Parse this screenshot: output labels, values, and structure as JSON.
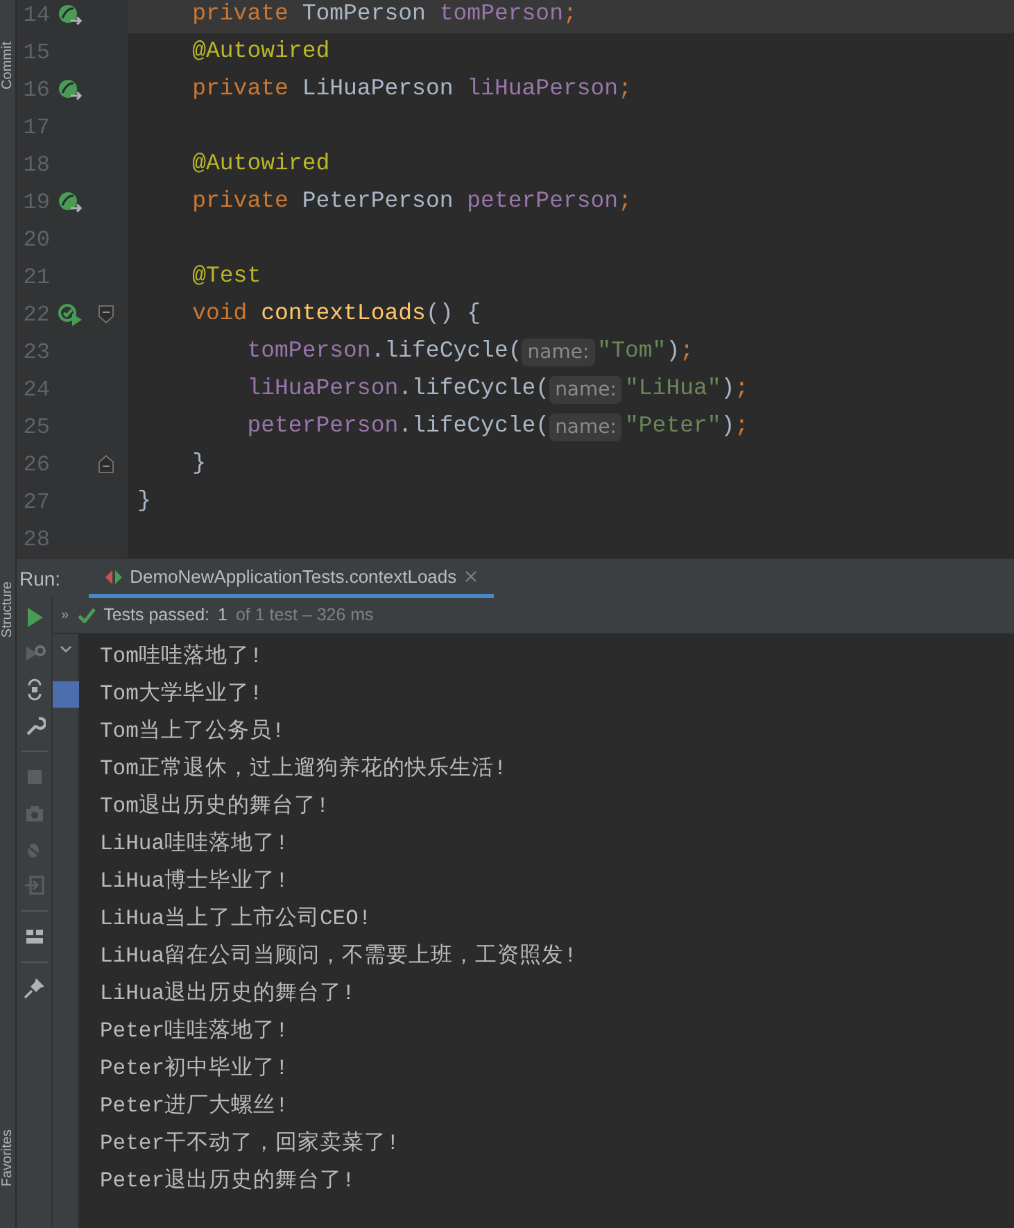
{
  "tool_strip": [
    "Commit",
    "Structure",
    "Favorites"
  ],
  "editor": {
    "lines": [
      {
        "number": "14",
        "gutter": {
          "kind": "bean"
        },
        "current": true,
        "tokens": [
          {
            "kind": "keyword",
            "text": "    private "
          },
          {
            "kind": "type",
            "text": "TomPerson "
          },
          {
            "kind": "field",
            "text": "tomPerson"
          },
          {
            "kind": "semi",
            "text": ";"
          }
        ]
      },
      {
        "number": "15",
        "current": false,
        "tokens": [
          {
            "kind": "annotation",
            "text": "    @Autowired"
          }
        ]
      },
      {
        "number": "16",
        "gutter": {
          "kind": "bean"
        },
        "current": false,
        "tokens": [
          {
            "kind": "keyword",
            "text": "    private "
          },
          {
            "kind": "type",
            "text": "LiHuaPerson "
          },
          {
            "kind": "field",
            "text": "liHuaPerson"
          },
          {
            "kind": "semi",
            "text": ";"
          }
        ]
      },
      {
        "number": "17",
        "current": false
      },
      {
        "number": "18",
        "current": false,
        "tokens": [
          {
            "kind": "annotation",
            "text": "    @Autowired"
          }
        ]
      },
      {
        "number": "19",
        "gutter": {
          "kind": "bean"
        },
        "current": false,
        "tokens": [
          {
            "kind": "keyword",
            "text": "    private "
          },
          {
            "kind": "type",
            "text": "PeterPerson "
          },
          {
            "kind": "field",
            "text": "peterPerson"
          },
          {
            "kind": "semi",
            "text": ";"
          }
        ]
      },
      {
        "number": "20",
        "current": false
      },
      {
        "number": "21",
        "current": false,
        "tokens": [
          {
            "kind": "annotation",
            "text": "    @Test"
          }
        ]
      },
      {
        "number": "22",
        "gutter": {
          "kind": "run-test"
        },
        "fold": {
          "kind": "start"
        },
        "current": false,
        "tokens": [
          {
            "kind": "keyword",
            "text": "    void "
          },
          {
            "kind": "method",
            "text": "contextLoads"
          },
          {
            "kind": "plain",
            "text": "() {"
          }
        ]
      },
      {
        "number": "23",
        "current": false,
        "tokens": [
          {
            "kind": "field",
            "text": "        tomPerson"
          },
          {
            "kind": "plain",
            "text": ".lifeCycle("
          },
          {
            "kind": "hint",
            "text": "name:"
          },
          {
            "kind": "string",
            "text": "\"Tom\""
          },
          {
            "kind": "plain",
            "text": ")"
          },
          {
            "kind": "semi",
            "text": ";"
          }
        ]
      },
      {
        "number": "24",
        "current": false,
        "tokens": [
          {
            "kind": "field",
            "text": "        liHuaPerson"
          },
          {
            "kind": "plain",
            "text": ".lifeCycle("
          },
          {
            "kind": "hint",
            "text": "name:"
          },
          {
            "kind": "string",
            "text": "\"LiHua\""
          },
          {
            "kind": "plain",
            "text": ")"
          },
          {
            "kind": "semi",
            "text": ";"
          }
        ]
      },
      {
        "number": "25",
        "current": false,
        "tokens": [
          {
            "kind": "field",
            "text": "        peterPerson"
          },
          {
            "kind": "plain",
            "text": ".lifeCycle("
          },
          {
            "kind": "hint",
            "text": "name:"
          },
          {
            "kind": "string",
            "text": "\"Peter\""
          },
          {
            "kind": "plain",
            "text": ")"
          },
          {
            "kind": "semi",
            "text": ";"
          }
        ]
      },
      {
        "number": "26",
        "fold": {
          "kind": "end"
        },
        "current": false,
        "tokens": [
          {
            "kind": "plain",
            "text": "    }"
          }
        ]
      },
      {
        "number": "27",
        "current": false,
        "tokens": [
          {
            "kind": "plain",
            "text": "}"
          }
        ]
      },
      {
        "number": "28",
        "current": false
      }
    ]
  },
  "run_panel": {
    "title": "Run:",
    "tabs": [
      {
        "label": "DemoNewApplicationTests.contextLoads",
        "selected": true
      }
    ],
    "status": {
      "expand": "»",
      "label": "Tests passed:",
      "count": "1",
      "detail": "of 1 test – 326 ms"
    },
    "output": [
      "Tom哇哇落地了!",
      "Tom大学毕业了!",
      "Tom当上了公务员!",
      "Tom正常退休，过上遛狗养花的快乐生活!",
      "Tom退出历史的舞台了!",
      "LiHua哇哇落地了!",
      "LiHua博士毕业了!",
      "LiHua当上了上市公司CEO!",
      "LiHua留在公司当顾问，不需要上班，工资照发!",
      "LiHua退出历史的舞台了!",
      "Peter哇哇落地了!",
      "Peter初中毕业了!",
      "Peter进厂大螺丝!",
      "Peter干不动了，回家卖菜了!",
      "Peter退出历史的舞台了!"
    ]
  }
}
